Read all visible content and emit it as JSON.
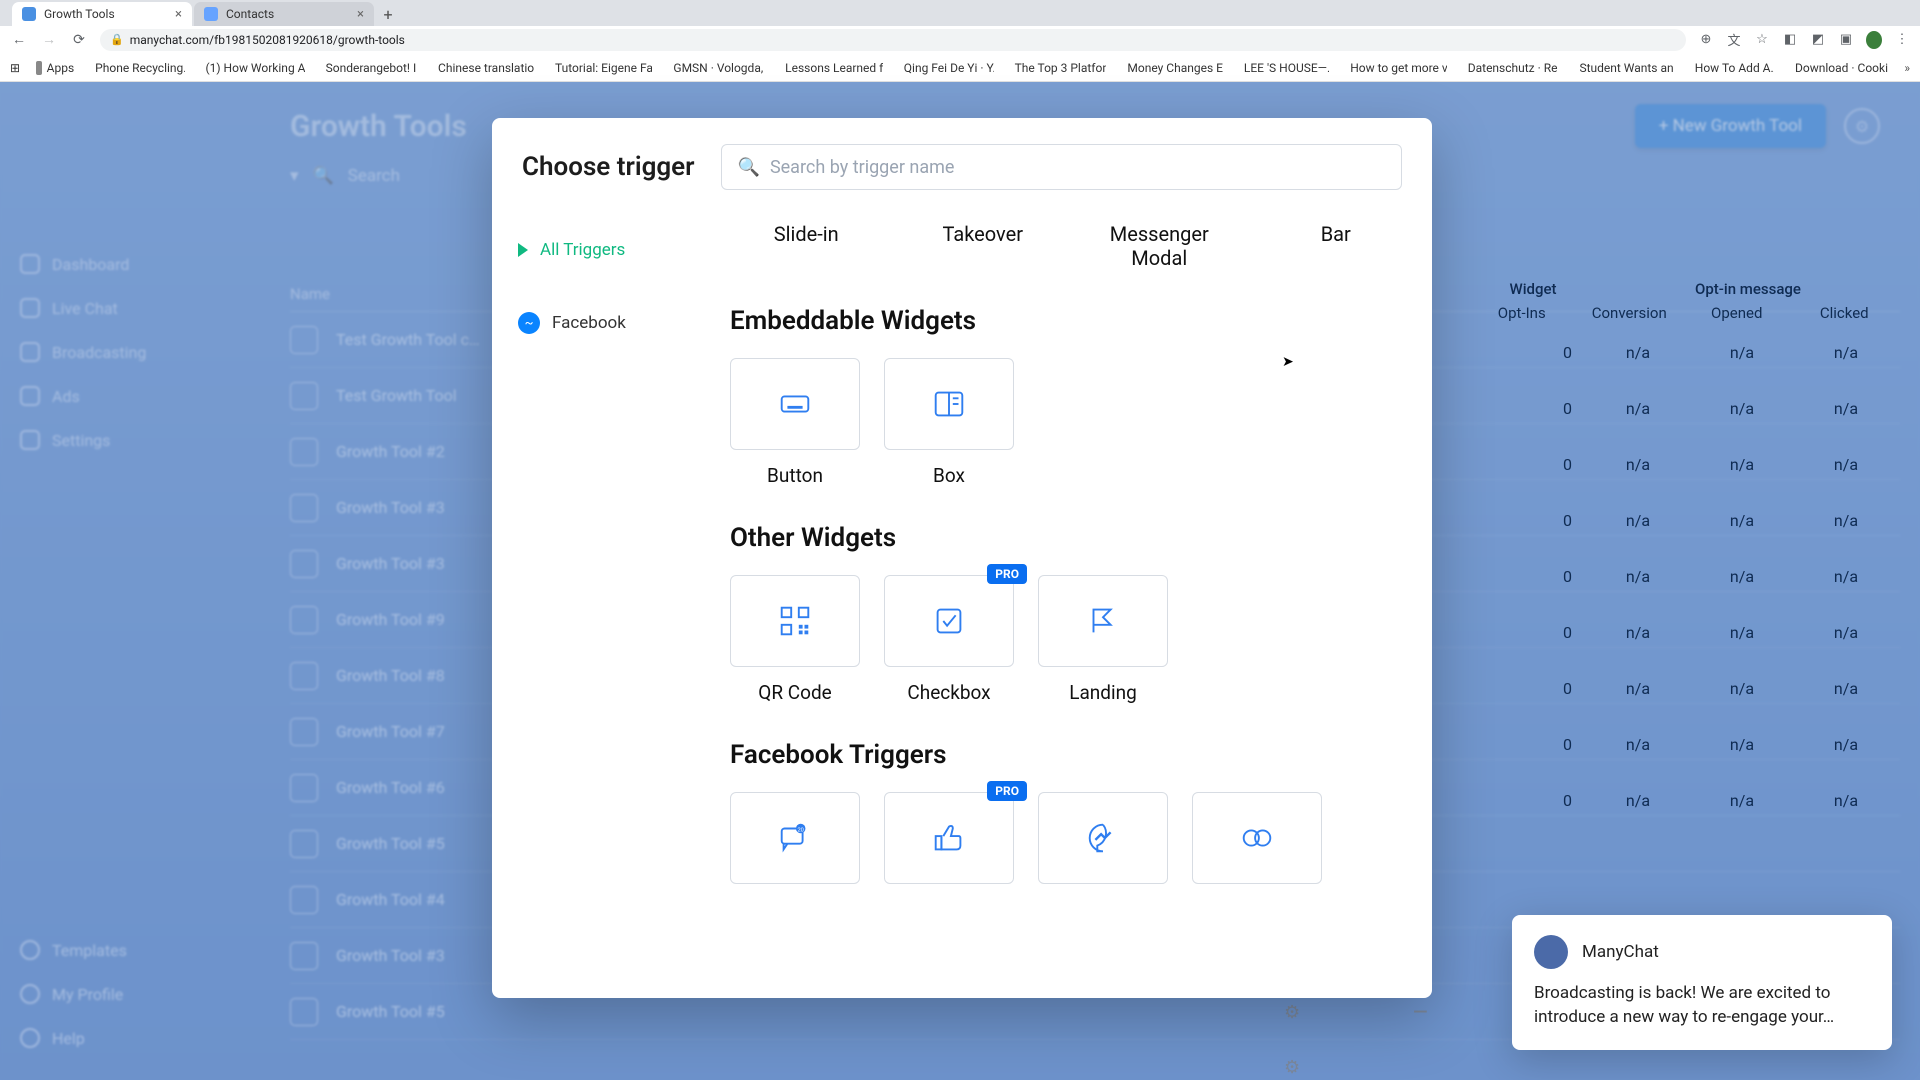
{
  "browser": {
    "tabs": [
      {
        "title": "Growth Tools",
        "active": true
      },
      {
        "title": "Contacts",
        "active": false
      }
    ],
    "url": "manychat.com/fb198150208192061­8/growth-tools",
    "bookmarks": [
      {
        "label": "Apps",
        "icon": "gray"
      },
      {
        "label": "Phone Recycling…",
        "icon": "gray"
      },
      {
        "label": "(1) How Working A…",
        "icon": "red"
      },
      {
        "label": "Sonderangebot! I…",
        "icon": "gray"
      },
      {
        "label": "Chinese translatio…",
        "icon": "gray"
      },
      {
        "label": "Tutorial: Eigene Fa…",
        "icon": "gray"
      },
      {
        "label": "GMSN · Vologda,…",
        "icon": "red"
      },
      {
        "label": "Lessons Learned f…",
        "icon": "gray"
      },
      {
        "label": "Qing Fei De Yi · Y…",
        "icon": "red"
      },
      {
        "label": "The Top 3 Platfor…",
        "icon": "red"
      },
      {
        "label": "Money Changes E…",
        "icon": "red"
      },
      {
        "label": "LEE 'S HOUSE—…",
        "icon": "gray"
      },
      {
        "label": "How to get more v…",
        "icon": "red"
      },
      {
        "label": "Datenschutz · Re…",
        "icon": "gray"
      },
      {
        "label": "Student Wants an…",
        "icon": "red"
      },
      {
        "label": "How To Add A…",
        "icon": "gray"
      },
      {
        "label": "Download · Cooki…",
        "icon": "folder"
      }
    ]
  },
  "bg": {
    "title": "Growth Tools",
    "new_button": "+ New Growth Tool",
    "search_placeholder": "Search",
    "name_header": "Name",
    "sidebar": [
      "Dashboard",
      "Live Chat",
      "Broadcasting",
      "Ads",
      "Settings"
    ],
    "sidebar_bottom": [
      "Templates",
      "My Profile",
      "Help"
    ],
    "rows": [
      "Test Growth Tool c…",
      "Test Growth Tool",
      "Growth Tool #2",
      "Growth Tool #3",
      "Growth Tool #3",
      "Growth Tool #9",
      "Growth Tool #8",
      "Growth Tool #7",
      "Growth Tool #6",
      "Growth Tool #5",
      "Growth Tool #4",
      "Growth Tool #3",
      "Growth Tool #5"
    ]
  },
  "stats": {
    "head1": "Widget",
    "head2": "Opt-in message",
    "sub": [
      "Opt-Ins",
      "Conversion",
      "Opened",
      "Clicked"
    ],
    "rows": [
      [
        "0",
        "n/a",
        "n/a",
        "n/a"
      ],
      [
        "0",
        "n/a",
        "n/a",
        "n/a"
      ],
      [
        "0",
        "n/a",
        "n/a",
        "n/a"
      ],
      [
        "0",
        "n/a",
        "n/a",
        "n/a"
      ],
      [
        "0",
        "n/a",
        "n/a",
        "n/a"
      ],
      [
        "0",
        "n/a",
        "n/a",
        "n/a"
      ],
      [
        "0",
        "n/a",
        "n/a",
        "n/a"
      ],
      [
        "0",
        "n/a",
        "n/a",
        "n/a"
      ],
      [
        "0",
        "n/a",
        "n/a",
        "n/a"
      ]
    ]
  },
  "modal": {
    "title": "Choose trigger",
    "search_placeholder": "Search by trigger name",
    "sidebar": {
      "all": "All Triggers",
      "fb": "Facebook"
    },
    "overlay_row": [
      "Slide-in",
      "Takeover",
      "Messenger Modal",
      "Bar"
    ],
    "sections": {
      "embeddable": {
        "title": "Embeddable Widgets",
        "items": [
          "Button",
          "Box"
        ]
      },
      "other": {
        "title": "Other Widgets",
        "items": [
          "QR Code",
          "Checkbox",
          "Landing"
        ],
        "pro_index": 1
      },
      "fb": {
        "title": "Facebook Triggers",
        "pro_index": 1
      }
    },
    "pro_badge": "PRO"
  },
  "toast": {
    "from": "ManyChat",
    "body": "Broadcasting is back! We are excited to introduce a new way to re-engage your…"
  }
}
